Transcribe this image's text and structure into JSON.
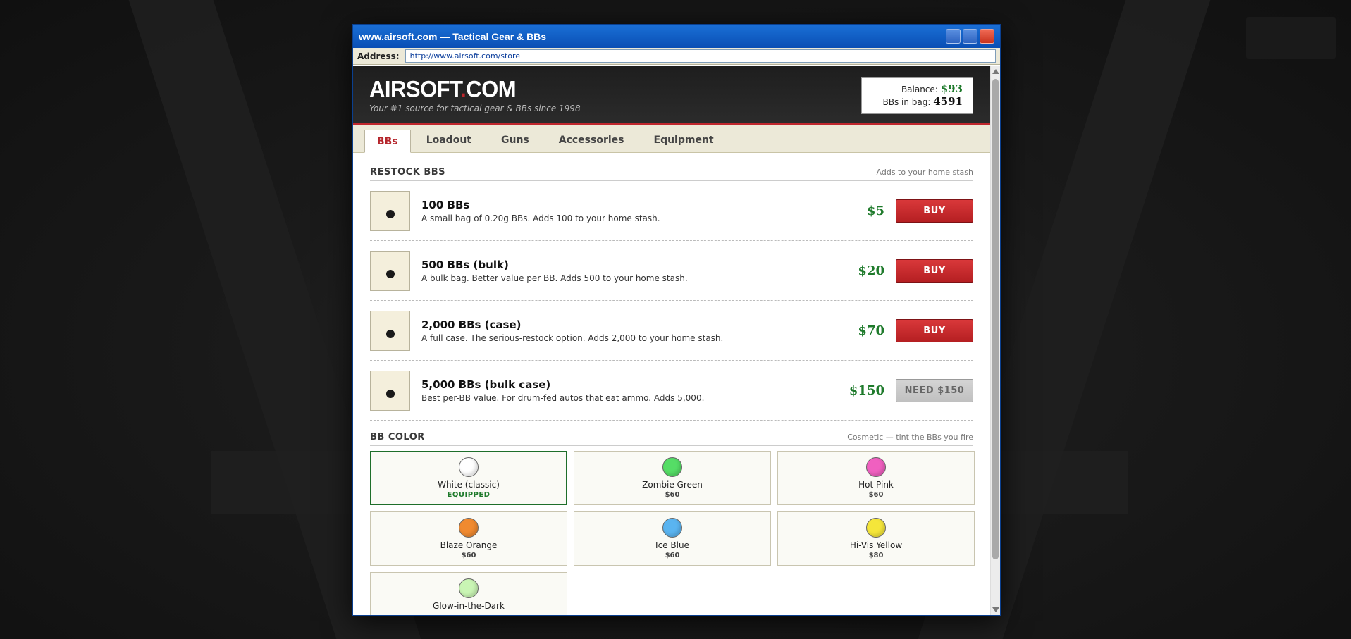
{
  "window": {
    "title": "www.airsoft.com — Tactical Gear & BBs",
    "address_label": "Address:",
    "url": "http://www.airsoft.com/store"
  },
  "header": {
    "logo_main": "AIRSOFT",
    "logo_dot": ".",
    "logo_tld": "COM",
    "tagline": "Your #1 source for tactical gear & BBs since 1998",
    "balance_label": "Balance:",
    "balance_value": "$93",
    "bbs_label": "BBs in bag:",
    "bbs_value": "4591"
  },
  "tabs": [
    {
      "label": "BBs",
      "active": true
    },
    {
      "label": "Loadout"
    },
    {
      "label": "Guns"
    },
    {
      "label": "Accessories"
    },
    {
      "label": "Equipment"
    }
  ],
  "restock": {
    "heading": "RESTOCK BBS",
    "note": "Adds to your home stash",
    "products": [
      {
        "name": "100 BBs",
        "desc": "A small bag of 0.20g BBs. Adds 100 to your home stash.",
        "price": "$5",
        "action": "BUY",
        "enabled": true
      },
      {
        "name": "500 BBs (bulk)",
        "desc": "A bulk bag. Better value per BB. Adds 500 to your home stash.",
        "price": "$20",
        "action": "BUY",
        "enabled": true
      },
      {
        "name": "2,000 BBs (case)",
        "desc": "A full case. The serious-restock option. Adds 2,000 to your home stash.",
        "price": "$70",
        "action": "BUY",
        "enabled": true
      },
      {
        "name": "5,000 BBs (bulk case)",
        "desc": "Best per-BB value. For drum-fed autos that eat ammo. Adds 5,000.",
        "price": "$150",
        "action": "NEED $150",
        "enabled": false
      }
    ]
  },
  "bb_color": {
    "heading": "BB COLOR",
    "note": "Cosmetic — tint the BBs you fire",
    "colors": [
      {
        "name": "White (classic)",
        "status": "EQUIPPED",
        "hex": "#ffffff"
      },
      {
        "name": "Zombie Green",
        "status": "$60",
        "hex": "#55dd66"
      },
      {
        "name": "Hot Pink",
        "status": "$60",
        "hex": "#f060c0"
      },
      {
        "name": "Blaze Orange",
        "status": "$60",
        "hex": "#f08a30"
      },
      {
        "name": "Ice Blue",
        "status": "$60",
        "hex": "#5ab4f0"
      },
      {
        "name": "Hi-Vis Yellow",
        "status": "$80",
        "hex": "#f5e63a"
      },
      {
        "name": "Glow-in-the-Dark",
        "status": "",
        "hex": "#c9f5b4"
      }
    ]
  },
  "colors": {
    "accent_red": "#c0272d",
    "price_green": "#1e7a2b"
  }
}
